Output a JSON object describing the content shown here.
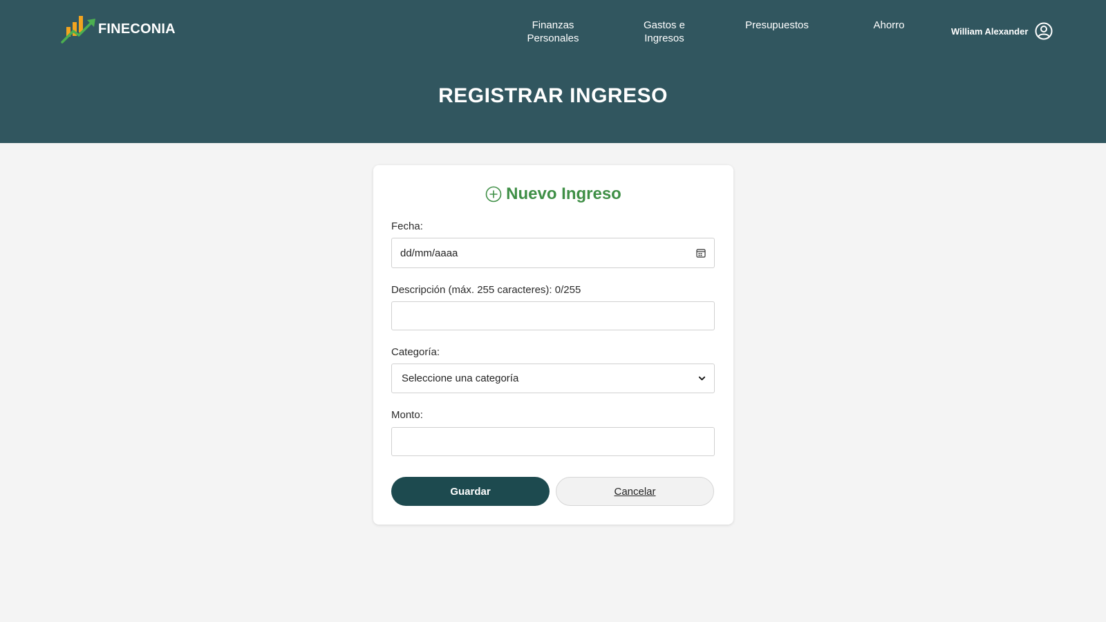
{
  "app": {
    "logo_text": "FINECONIA"
  },
  "nav": [
    {
      "line1": "Finanzas",
      "line2": "Personales"
    },
    {
      "line1": "Gastos e",
      "line2": "Ingresos"
    },
    {
      "line1": "Presupuestos",
      "line2": ""
    },
    {
      "line1": "Ahorro",
      "line2": ""
    }
  ],
  "user": {
    "name": "William Alexander",
    "icon": "user-circle-icon"
  },
  "page": {
    "title": "REGISTRAR INGRESO"
  },
  "form": {
    "title": "Nuevo Ingreso",
    "title_icon": "plus-circle-icon",
    "fecha_label": "Fecha:",
    "fecha_placeholder": "dd/mm/aaaa",
    "descripcion_label": "Descripción (máx. 255 caracteres): 0/255",
    "descripcion_value": "",
    "categoria_label": "Categoría:",
    "categoria_selected": "Seleccione una categoría",
    "monto_label": "Monto:",
    "monto_value": "",
    "save_label": "Guardar",
    "cancel_label": "Cancelar"
  },
  "colors": {
    "header_bg": "#31565f",
    "accent_green": "#3f8f46",
    "button_dark": "#1d4a4f",
    "page_bg": "#f4f4f4"
  }
}
